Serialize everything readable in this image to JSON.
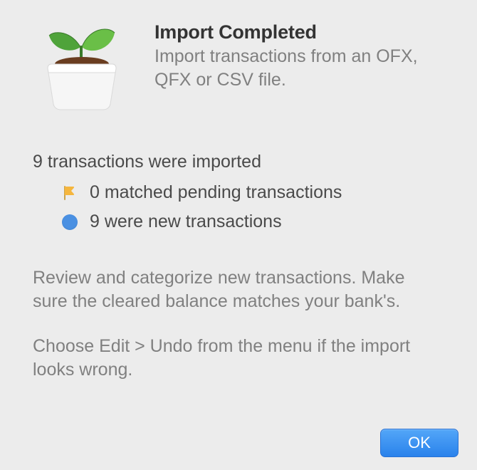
{
  "dialog": {
    "title": "Import Completed",
    "subtitle": "Import transactions from an OFX, QFX or CSV file."
  },
  "summary": {
    "heading": "9 transactions were imported",
    "items": [
      {
        "icon": "flag-icon",
        "text": "0 matched pending transactions"
      },
      {
        "icon": "dot-icon",
        "text": "9 were new transactions"
      }
    ]
  },
  "notes": {
    "review": "Review and categorize new transactions. Make sure the cleared balance matches your bank's.",
    "undo": "Choose Edit > Undo from the menu if the import looks wrong."
  },
  "buttons": {
    "ok_label": "OK"
  },
  "colors": {
    "flag": "#f5b63e",
    "dot": "#4a90e2",
    "accent": "#2a82eb"
  }
}
